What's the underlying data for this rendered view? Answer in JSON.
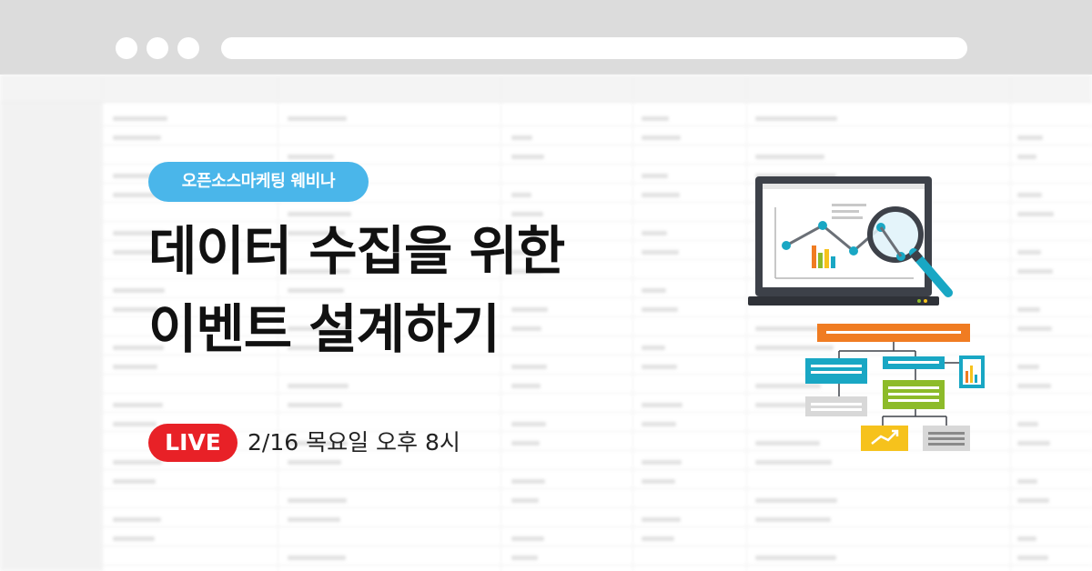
{
  "banner": {
    "tag": "오픈소스마케팅 웨비나",
    "title_line1": "데이터 수집을 위한",
    "title_line2": "이벤트 설계하기",
    "live_badge": "LIVE",
    "schedule": "2/16 목요일 오후 8시"
  },
  "colors": {
    "tag_bg": "#4ab6ea",
    "live_bg": "#e82127",
    "title": "#111111",
    "browser_chrome": "#dcdcdc",
    "illus_orange": "#f07c22",
    "illus_teal": "#19a7c4",
    "illus_green": "#8dbb2a",
    "illus_yellow": "#f6c21c",
    "illus_gray": "#d8d8d8"
  },
  "icons": [
    "window-control-dot-icon",
    "laptop-analytics-icon",
    "magnifier-icon",
    "flowchart-icon",
    "bar-chart-icon",
    "trend-chart-icon"
  ]
}
